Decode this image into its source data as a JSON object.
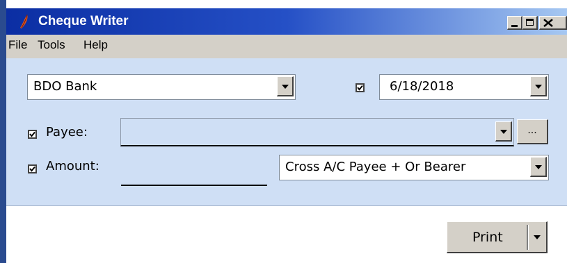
{
  "window": {
    "title": "Cheque Writer"
  },
  "menu": {
    "items": [
      "File",
      "Tools",
      "Help"
    ]
  },
  "form": {
    "bank": "BDO Bank",
    "date_enabled": true,
    "date": "6/18/2018",
    "payee_enabled": true,
    "payee_label": "Payee:",
    "payee_value": "",
    "ellipsis_label": "...",
    "amount_enabled": true,
    "amount_label": "Amount:",
    "amount_value": "",
    "crossing": "Cross A/C Payee + Or Bearer"
  },
  "actions": {
    "print_label": "Print"
  },
  "colors": {
    "titlebar_start": "#0b2ea3",
    "titlebar_end": "#a6c8f2",
    "panel": "#cfdff5",
    "menubar": "#d4d0c8"
  }
}
